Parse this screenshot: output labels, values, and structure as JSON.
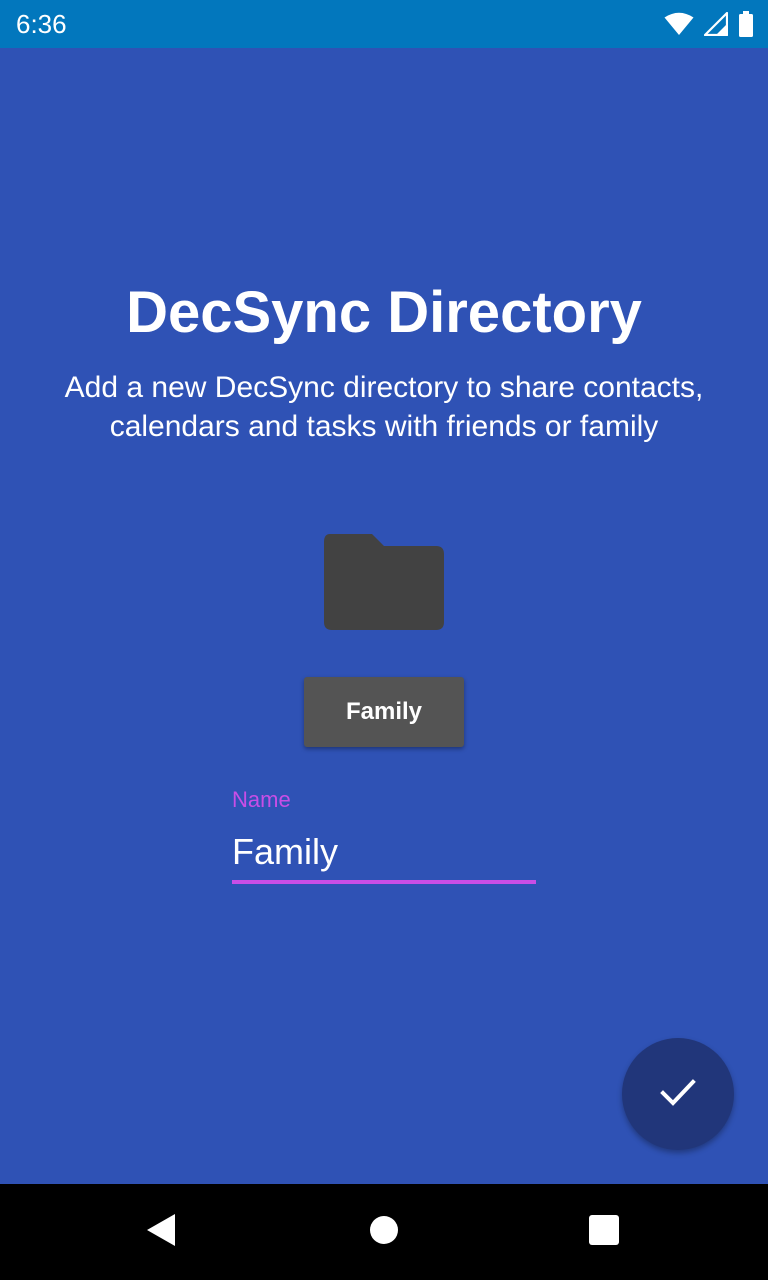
{
  "status_bar": {
    "time": "6:36",
    "icons": [
      "wifi-icon",
      "cellular-signal-icon",
      "battery-icon"
    ]
  },
  "main": {
    "title": "DecSync Directory",
    "subtitle": "Add a new DecSync directory to share contacts, calendars and tasks with friends or family",
    "folder_icon": "folder-icon",
    "directory_button_label": "Family",
    "name_field": {
      "label": "Name",
      "value": "Family"
    },
    "fab_icon": "check-icon"
  },
  "nav_bar": {
    "icons": [
      "back-icon",
      "home-icon",
      "recents-icon"
    ]
  },
  "colors": {
    "background": "#2f52b5",
    "status_bar": "#0277bd",
    "accent": "#c84ee6",
    "button": "#545454",
    "fab": "#21367a",
    "folder": "#424242"
  }
}
